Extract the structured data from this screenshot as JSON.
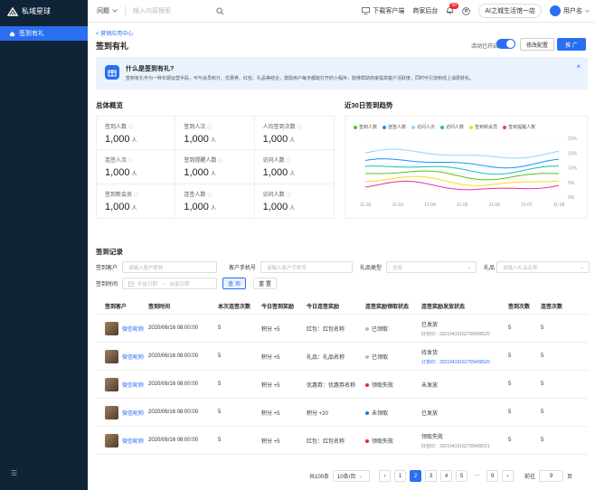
{
  "app": {
    "name": "私域星球"
  },
  "sidebar": {
    "active_item": "签到有礼",
    "collapse": "☰"
  },
  "topbar": {
    "question": "问题",
    "search_placeholder": "输入内容搜索",
    "download": "下载客户端",
    "merchant": "商家后台",
    "badge": "99",
    "ai_pill": "AI之城生活馆一店",
    "user": "用户名"
  },
  "page": {
    "breadcrumb": "< 营销应用中心",
    "title": "签到有礼",
    "switch_label": "活动已开启",
    "config_button": "修改配置",
    "promo_button": "推 广"
  },
  "info": {
    "title": "什么是签到有礼?",
    "desc": "签到有礼作为一种长期运营手段，可与会员积分、优惠券、红包、礼品等结合，激励用户每天都能打开的小程序，能够帮助商家提高客户活跃度，同时可引流到线上消费转化。",
    "close": "×"
  },
  "overview": {
    "title": "总体概览",
    "stats": [
      {
        "label": "签到人数",
        "value": "1,000",
        "unit": "人"
      },
      {
        "label": "签到人次",
        "value": "1,000",
        "unit": "人"
      },
      {
        "label": "人均签到次数",
        "value": "1,000",
        "unit": "人"
      },
      {
        "label": "连签人次",
        "value": "1,000",
        "unit": "人"
      },
      {
        "label": "签到提醒人数",
        "value": "1,000",
        "unit": "人"
      },
      {
        "label": "访问人数",
        "value": "1,000",
        "unit": "人"
      },
      {
        "label": "签到新会员",
        "value": "1,000",
        "unit": "人"
      },
      {
        "label": "连签人数",
        "value": "1,000",
        "unit": "人"
      },
      {
        "label": "访问人数",
        "value": "1,000",
        "unit": "人"
      }
    ]
  },
  "trend": {
    "title": "近30日签到趋势",
    "legend": [
      {
        "name": "签到人数",
        "color": "#52c41a"
      },
      {
        "name": "连签人数",
        "color": "#1890ff"
      },
      {
        "name": "访问人次",
        "color": "#91d5ff"
      },
      {
        "name": "访问人数",
        "color": "#13c2c2"
      },
      {
        "name": "签到新会员",
        "color": "#fadb14"
      },
      {
        "name": "签到提醒人数",
        "color": "#eb2f96"
      }
    ],
    "x_labels": [
      "11-02",
      "11-03",
      "11-04",
      "11-05",
      "11-06",
      "11-07",
      "11-08"
    ],
    "y_labels": [
      "20%",
      "15%",
      "10%",
      "5%",
      "0%"
    ]
  },
  "records": {
    "title": "签到记录",
    "filters": {
      "customer_label": "签到客户",
      "customer_placeholder": "请输入客户昵称",
      "phone_label": "客户手机号",
      "phone_placeholder": "请输入客户手机号",
      "gift_type_label": "礼品类型",
      "gift_type_value": "全部",
      "gift_label": "礼品",
      "gift_placeholder": "请输入礼品名称",
      "time_label": "签到时间",
      "start_placeholder": "开始日期",
      "end_placeholder": "结束日期",
      "query": "查 询",
      "reset": "重 置"
    },
    "columns": [
      "签到客户",
      "签到时间",
      "本次连签次数",
      "今日签到奖励",
      "今日连签奖励",
      "连签奖励领取状态",
      "连签奖励发放状态",
      "签到次数",
      "连签次数"
    ],
    "rows": [
      {
        "nick": "微信昵称",
        "time": "2020/06/16 08:00:00",
        "streak": "5",
        "reward": "积分 +5",
        "streak_reward": "红包：红包名称",
        "claim": "已领取",
        "claim_color": "#bbbbbb",
        "dispatch": "已发放",
        "dispatch_sub": "红包ID：20210416162755499520",
        "sub_blue": false,
        "count": "5",
        "streak_count": "5"
      },
      {
        "nick": "微信昵称",
        "time": "2020/06/16 08:00:00",
        "streak": "5",
        "reward": "积分 +5",
        "streak_reward": "礼品：礼品名称",
        "claim": "已领取",
        "claim_color": "#bbbbbb",
        "dispatch": "待发货",
        "dispatch_sub": "订单ID：20210416162755499520",
        "sub_blue": true,
        "count": "5",
        "streak_count": "5"
      },
      {
        "nick": "微信昵称",
        "time": "2020/06/16 08:00:00",
        "streak": "5",
        "reward": "积分 +5",
        "streak_reward": "优惠券：优惠券名称",
        "claim": "领取失败",
        "claim_color": "#f5222d",
        "dispatch": "未发放",
        "dispatch_sub": "",
        "sub_blue": false,
        "count": "5",
        "streak_count": "5"
      },
      {
        "nick": "微信昵称",
        "time": "2020/06/16 08:00:00",
        "streak": "5",
        "reward": "积分 +5",
        "streak_reward": "积分 +20",
        "claim": "未领取",
        "claim_color": "#2a6ff2",
        "dispatch": "已发放",
        "dispatch_sub": "",
        "sub_blue": false,
        "count": "5",
        "streak_count": "5"
      },
      {
        "nick": "微信昵称",
        "time": "2020/06/16 08:00:00",
        "streak": "5",
        "reward": "积分 +5",
        "streak_reward": "红包：红包名称",
        "claim": "领取失败",
        "claim_color": "#f5222d",
        "dispatch": "领取失败",
        "dispatch_sub": "红包ID：20210416162755499521",
        "sub_blue": false,
        "count": "5",
        "streak_count": "5"
      }
    ]
  },
  "pagination": {
    "total": "共100条",
    "page_size": "10条/页",
    "pages": [
      "1",
      "2",
      "3",
      "4",
      "5",
      "···",
      "9"
    ],
    "current": "2",
    "goto_label": "前往",
    "goto_value": "9",
    "goto_suffix": "页"
  }
}
